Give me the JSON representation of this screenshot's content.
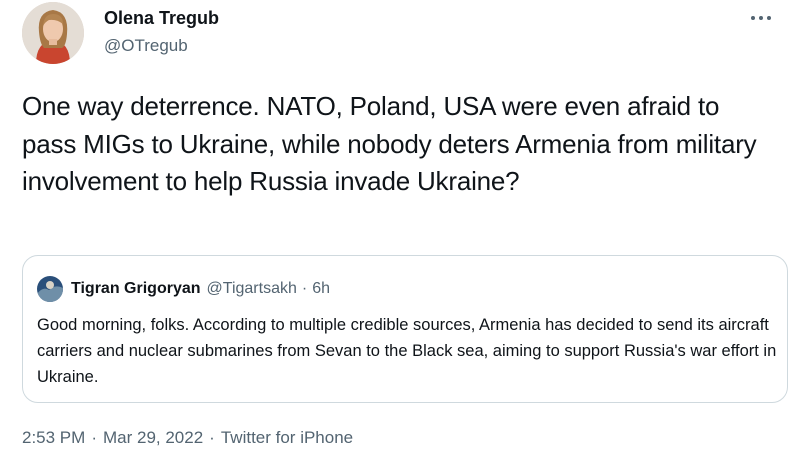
{
  "author": {
    "name": "Olena Tregub",
    "handle": "@OTregub"
  },
  "menu": {
    "icon": "more-horizontal-icon"
  },
  "tweet": {
    "text": "One way deterrence. NATO, Poland, USA were even afraid to pass MIGs to Ukraine, while nobody deters Armenia from military involvement to help Russia invade Ukraine?"
  },
  "quote": {
    "name": "Tigran Grigoryan",
    "handle": "@Tigartsakh",
    "separator": "·",
    "time": "6h",
    "text": "Good morning, folks. According to multiple credible sources, Armenia has decided to send its aircraft carriers and nuclear submarines from Sevan to the Black sea, aiming to support Russia's war effort in Ukraine."
  },
  "meta": {
    "time": "2:53 PM",
    "date": "Mar 29, 2022",
    "source": "Twitter for iPhone",
    "separator": "·"
  },
  "colors": {
    "text": "#0f1419",
    "secondary": "#536471",
    "border": "#cfd9de"
  }
}
